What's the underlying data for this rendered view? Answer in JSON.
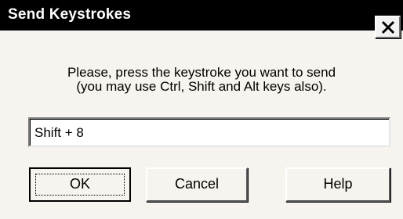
{
  "window": {
    "title": "Send Keystrokes",
    "close_icon": "close-icon"
  },
  "prompt": {
    "line1": "Please, press the keystroke you want to send",
    "line2": "(you may use Ctrl, Shift and Alt keys also)."
  },
  "keystroke_field": {
    "value": "Shift + 8"
  },
  "buttons": {
    "ok": "OK",
    "cancel": "Cancel",
    "help": "Help"
  }
}
